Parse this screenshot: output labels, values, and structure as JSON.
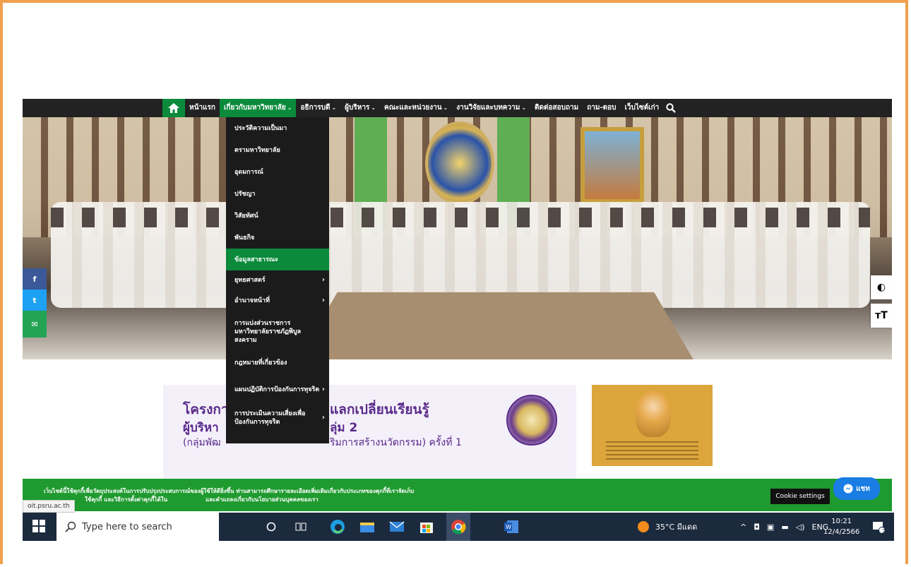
{
  "nav": {
    "home_icon": "home-icon",
    "items": [
      {
        "label": "หน้าแรก",
        "caret": ""
      },
      {
        "label": "เกี่ยวกับมหาวิทยาลัย",
        "caret": "⌄"
      },
      {
        "label": "อธิการบดี",
        "caret": "⌄"
      },
      {
        "label": "ผู้บริหาร",
        "caret": "⌄"
      },
      {
        "label": "คณะและหน่วยงาน",
        "caret": "⌄"
      },
      {
        "label": "งานวิจัยและบทความ",
        "caret": "⌄"
      },
      {
        "label": "ติดต่อสอบถาม",
        "caret": ""
      },
      {
        "label": "ถาม-ตอบ",
        "caret": ""
      },
      {
        "label": "เว็บไซต์เก่า",
        "caret": ""
      }
    ],
    "search_icon": "search-icon",
    "accent": "#0a8a3a"
  },
  "dropdown": {
    "items": [
      {
        "label": "ประวัติความเป็นมา",
        "arrow": ""
      },
      {
        "label": "ตรามหาวิทยาลัย",
        "arrow": ""
      },
      {
        "label": "อุดมการณ์",
        "arrow": ""
      },
      {
        "label": "ปรัชญา",
        "arrow": ""
      },
      {
        "label": "วิสัยทัศน์",
        "arrow": ""
      },
      {
        "label": "พันธกิจ",
        "arrow": ""
      },
      {
        "label": "ข้อมูลสาธารณะ",
        "arrow": ""
      },
      {
        "label": "ยุทธศาสตร์",
        "arrow": "›"
      },
      {
        "label": "อำนาจหน้าที่",
        "arrow": "›"
      },
      {
        "label": "การแบ่งส่วนราชการ มหาวิทยาลัยราชภัฏพิบูลสงคราม",
        "arrow": ""
      },
      {
        "label": "กฎหมายที่เกี่ยวข้อง",
        "arrow": ""
      },
      {
        "label": "แผนปฏิบัติการป้องกันการทุจริต",
        "arrow": "›"
      },
      {
        "label": "การประเมินความเสี่ยงเพื่อป้องกันการทุจริต",
        "arrow": "›"
      }
    ]
  },
  "share": {
    "facebook": "f",
    "twitter": "t",
    "email": "✉"
  },
  "accessibility": {
    "contrast": "◐",
    "text_size": "тT"
  },
  "banner": {
    "line1": "โครงกา",
    "line1b": "แลกเปลี่ยนเรียนรู้",
    "line2": "ผู้บริหา",
    "line2b": "ลุ่ม 2",
    "line3": "(กลุ่มพัฒ",
    "line3b": "ริมการสร้างนวัตกรรม) ครั้งที่ 1"
  },
  "cookie": {
    "line1": "เว็บไซต์นี้ใช้คุกกี้เพื่อวัตถุประสงค์ในการปรับปรุงประสบการณ์ของผู้ใช้ให้ดียิ่งขึ้น ท่านสามารถศึกษารายละเอียดเพิ่มเติมเกี่ยวกับประเภทของคุกกี้ที่เราจัดเก็บ",
    "line2a": "ใช้คุกกี้ และวิธีการตั้งค่าคุกกี้ได้ใน",
    "line2b": "และคำแถลงเกี่ยวกับนโยบายส่วนบุคคลของเรา",
    "settings_label": "Cookie settings",
    "chat_label": "แชท"
  },
  "status_url": "oit.psru.ac.th",
  "taskbar": {
    "search_placeholder": "Type here to search",
    "weather": "35°C มีแดด",
    "lang": "ENG",
    "time": "10:21",
    "date": "12/4/2566",
    "notification_count": "2"
  }
}
